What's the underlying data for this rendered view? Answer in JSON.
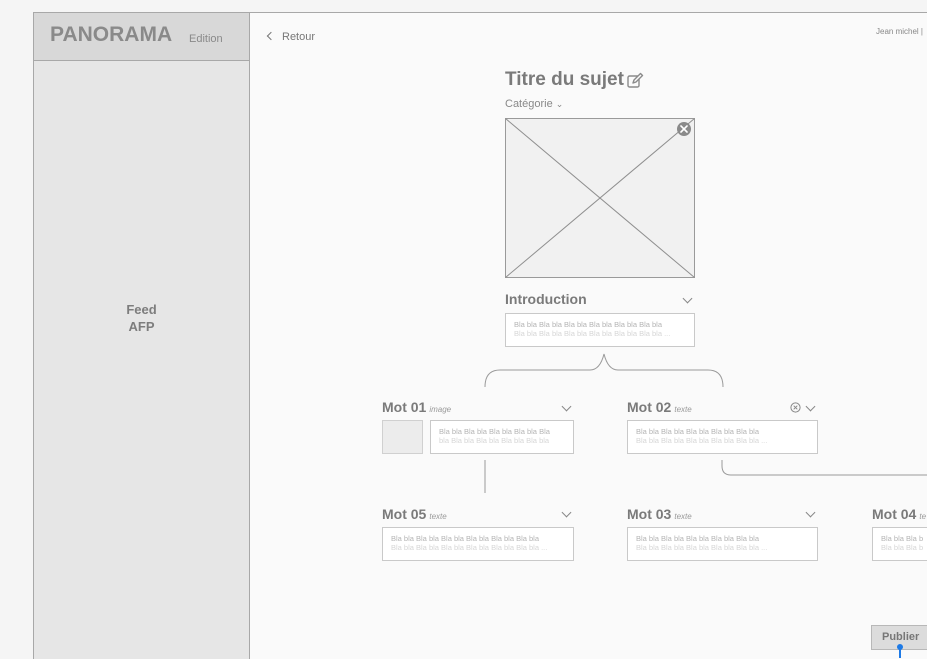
{
  "sidebar": {
    "brand_name": "PANORAMA",
    "brand_edition": "Edition",
    "feed_line1": "Feed",
    "feed_line2": "AFP"
  },
  "header": {
    "back_label": "Retour",
    "user": "Jean michel |"
  },
  "subject": {
    "title": "Titre du sujet",
    "category": "Catégorie",
    "icons": [
      "edit-icon",
      "chevron-down-icon",
      "image-placeholder",
      "close-circle-icon"
    ]
  },
  "intro": {
    "title": "Introduction",
    "line1": "Bla bla Bla bla Bla bla Bla bla Bla bla Bla bla",
    "line2": "Bla bla Bla bla Bla bla Bla bla Bla bla Bla bla ..."
  },
  "nodes": {
    "mot01": {
      "title": "Mot 01",
      "type": "image",
      "line1": "Bla bla Bla bla Bla bla Bla bla Bla",
      "line2": "bla Bla bla Bla bla Bla bla Bla bla"
    },
    "mot02": {
      "title": "Mot 02",
      "type": "texte",
      "line1": "Bla bla Bla bla Bla bla Bla bla Bla bla",
      "line2": "Bla bla Bla bla Bla bla Bla bla Bla bla ..."
    },
    "mot05": {
      "title": "Mot 05",
      "type": "texte",
      "line1": "Bla bla Bla bla Bla bla Bla bla Bla bla Bla bla",
      "line2": "Bla bla Bla bla Bla bla Bla bla Bla bla Bla bla ..."
    },
    "mot03": {
      "title": "Mot 03",
      "type": "texte",
      "line1": "Bla bla Bla bla Bla bla Bla bla Bla bla",
      "line2": "Bla bla Bla bla Bla bla Bla bla Bla bla ..."
    },
    "mot04": {
      "title": "Mot 04",
      "type": "te",
      "line1": "Bla bla Bla b",
      "line2": "Bla bla Bla b"
    }
  },
  "footer": {
    "publish_label": "Publier"
  },
  "colors": {
    "sidebar_bg": "#e6e6e6",
    "brand_bg": "#d8d8d8",
    "accent_pin": "#1e7ae6"
  }
}
